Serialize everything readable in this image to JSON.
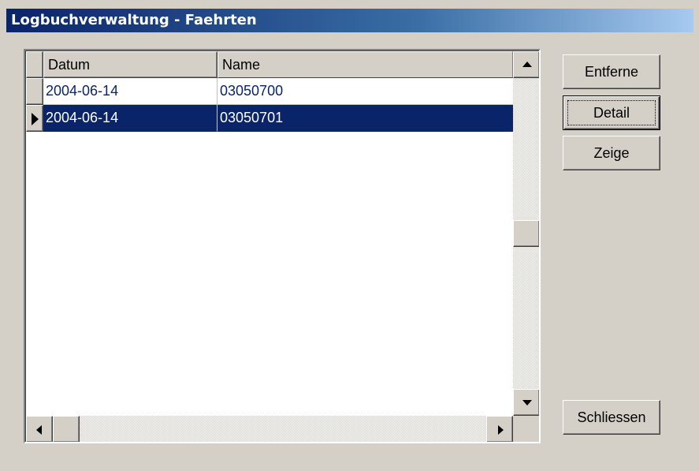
{
  "window": {
    "title": "Logbuchverwaltung - Faehrten"
  },
  "grid": {
    "columns": [
      "Datum",
      "Name"
    ],
    "rows": [
      {
        "datum": "2004-06-14",
        "name": "03050700",
        "selected": false
      },
      {
        "datum": "2004-06-14",
        "name": "03050701",
        "selected": true
      }
    ],
    "row_indicator_icon": "arrow-right-icon"
  },
  "buttons": {
    "entferne": "Entferne",
    "detail": "Detail",
    "zeige": "Zeige",
    "schliessen": "Schliessen"
  },
  "colors": {
    "selection": "#0a246a",
    "face": "#d4d0c8"
  }
}
